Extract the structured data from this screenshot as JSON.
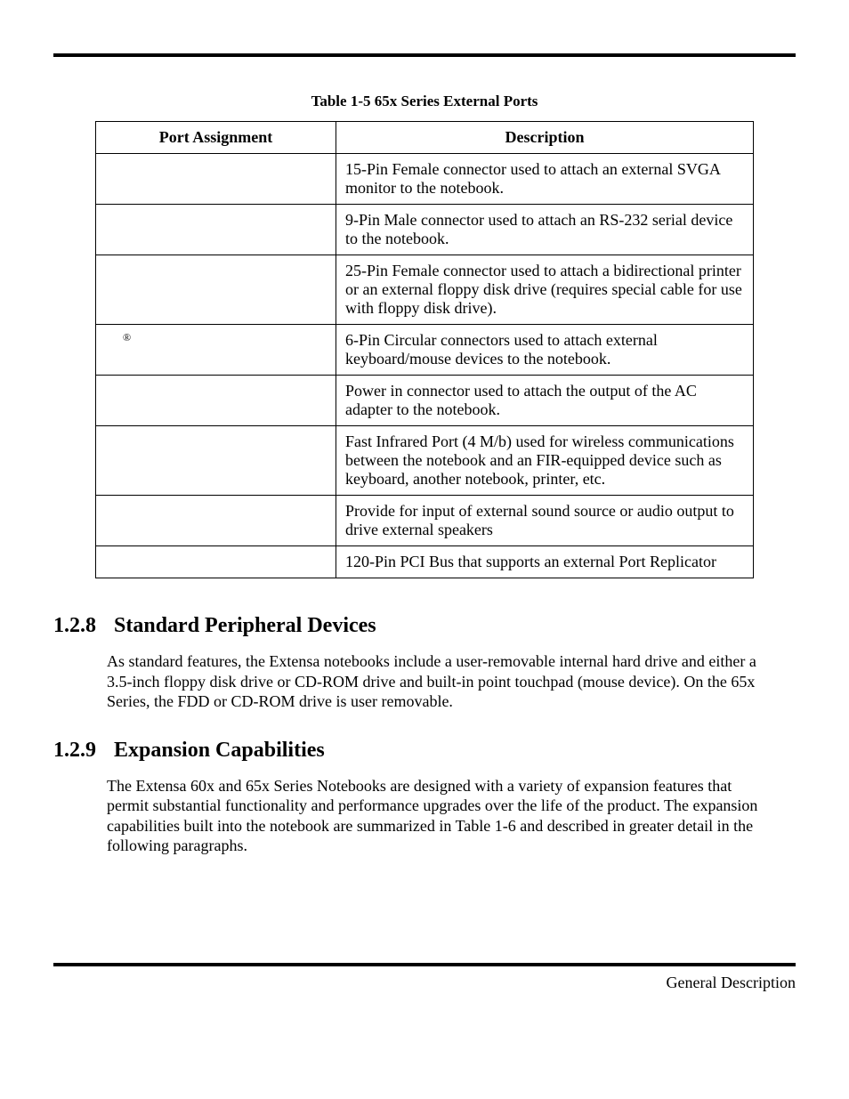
{
  "table": {
    "caption": "Table 1-5  65x Series External Ports",
    "headers": {
      "c1": "Port Assignment",
      "c2": "Description"
    },
    "rows": [
      {
        "port": "",
        "desc": "15-Pin Female connector used to attach an external SVGA monitor to the notebook."
      },
      {
        "port": "",
        "desc": "9-Pin Male connector used to attach an RS-232 serial device to the notebook."
      },
      {
        "port": "",
        "desc": "25-Pin Female connector used to attach a bidirectional printer or an external floppy disk drive (requires special cable for use with floppy disk drive)."
      },
      {
        "port": "®",
        "desc": "6-Pin Circular connectors used to attach external keyboard/mouse devices to the notebook."
      },
      {
        "port": "",
        "desc": "Power in connector used to attach the output of the AC adapter to the notebook."
      },
      {
        "port": "",
        "desc": "Fast Infrared Port (4 M/b) used for wireless communications between the notebook and an FIR-equipped device such as keyboard, another notebook, printer, etc."
      },
      {
        "port": "",
        "desc": "Provide for input of external sound source or audio output to drive external speakers"
      },
      {
        "port": "",
        "desc": "120-Pin PCI Bus that supports an external Port Replicator"
      }
    ]
  },
  "sections": {
    "s1": {
      "num": "1.2.8",
      "title": "Standard Peripheral Devices",
      "body": "As standard features, the Extensa notebooks include a user-removable internal hard drive and either a 3.5-inch floppy disk drive or CD-ROM drive and built-in point touchpad (mouse device). On the 65x Series, the FDD or CD-ROM drive is user removable."
    },
    "s2": {
      "num": "1.2.9",
      "title": "Expansion Capabilities",
      "body": "The Extensa 60x and 65x Series Notebooks are designed with a variety of expansion features that permit substantial functionality and performance upgrades over the life of the product. The expansion capabilities built into the notebook are summarized in Table 1-6 and described in greater detail in the following paragraphs."
    }
  },
  "footer": "General Description"
}
